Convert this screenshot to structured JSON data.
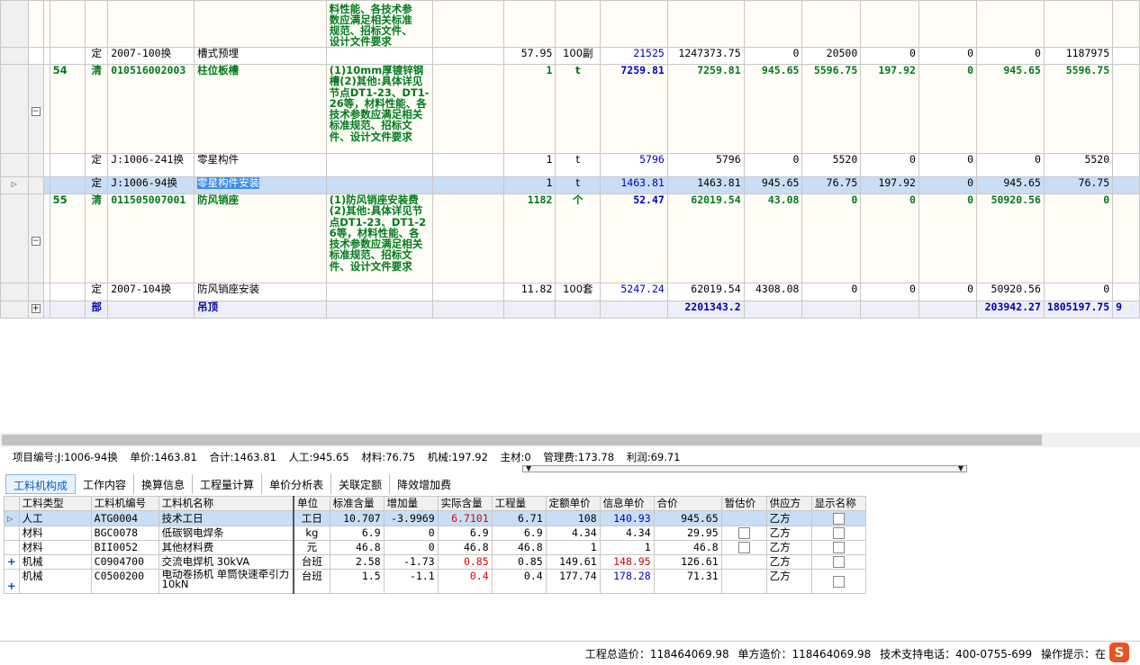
{
  "top_grid": {
    "overflow_row": {
      "description_lines": [
        "料性能、各技术参",
        "数应满足相关标准",
        "规范、招标文件、",
        "设计文件要求"
      ]
    },
    "rows": [
      {
        "kind": "quota",
        "cat": "定",
        "code": "2007-100换",
        "name": "槽式预埋",
        "desc": "",
        "qty": "57.95",
        "unit": "100副",
        "price": "21525",
        "total": "1247373.75",
        "c1": "0",
        "c2": "20500",
        "c3": "0",
        "c4": "0",
        "c5": "0",
        "c6": "1187975"
      },
      {
        "kind": "list",
        "seq": "54",
        "cat": "清",
        "code": "010516002003",
        "name": "柱位板槽",
        "desc": "(1)10mm厚镀锌钢槽(2)其他:具体详见节点DT1-23、DT1-26等，材料性能、各技术参数应满足相关标准规范、招标文件、设计文件要求",
        "qty": "1",
        "unit": "t",
        "price": "7259.81",
        "total": "7259.81",
        "c1": "945.65",
        "c2": "5596.75",
        "c3": "197.92",
        "c4": "0",
        "c5": "945.65",
        "c6": "5596.75"
      },
      {
        "kind": "quota",
        "cat": "定",
        "code": "J:1006-241换",
        "name": "零星构件",
        "desc": "",
        "qty": "1",
        "unit": "t",
        "price": "5796",
        "total": "5796",
        "c1": "0",
        "c2": "5520",
        "c3": "0",
        "c4": "0",
        "c5": "0",
        "c6": "5520"
      },
      {
        "kind": "selected",
        "cat": "定",
        "code": "J:1006-94换",
        "name": "零星构件安装",
        "desc": "",
        "qty": "1",
        "unit": "t",
        "price": "1463.81",
        "total": "1463.81",
        "c1": "945.65",
        "c2": "76.75",
        "c3": "197.92",
        "c4": "0",
        "c5": "945.65",
        "c6": "76.75"
      },
      {
        "kind": "list",
        "seq": "55",
        "cat": "清",
        "code": "011505007001",
        "name": "防风销座",
        "desc": "(1)防风销座安装费(2)其他:具体详见节点DT1-23、DT1-26等，材料性能、各技术参数应满足相关标准规范、招标文件、设计文件要求",
        "qty": "1182",
        "unit": "个",
        "price": "52.47",
        "total": "62019.54",
        "c1": "43.08",
        "c2": "0",
        "c3": "0",
        "c4": "0",
        "c5": "50920.56",
        "c6": "0"
      },
      {
        "kind": "quota",
        "cat": "定",
        "code": "2007-104换",
        "name": "防风销座安装",
        "desc": "",
        "qty": "11.82",
        "unit": "100套",
        "price": "5247.24",
        "total": "62019.54",
        "c1": "4308.08",
        "c2": "0",
        "c3": "0",
        "c4": "0",
        "c5": "50920.56",
        "c6": "0"
      },
      {
        "kind": "section",
        "cat": "部",
        "code": "",
        "name": "吊顶",
        "desc": "",
        "qty": "",
        "unit": "",
        "price": "",
        "total": "2201343.2",
        "c1": "",
        "c2": "",
        "c3": "",
        "c4": "",
        "c5": "203942.27",
        "c6": "1805197.75",
        "c7": "9"
      }
    ]
  },
  "info_bar": {
    "code": "项目编号:J:1006-94换",
    "unit_price": "单价:1463.81",
    "total": "合计:1463.81",
    "labor": "人工:945.65",
    "material": "材料:76.75",
    "machine": "机械:197.92",
    "main_material": "主材:0",
    "management": "管理费:173.78",
    "profit": "利润:69.71"
  },
  "tabs": [
    "工料机构成",
    "工作内容",
    "换算信息",
    "工程量计算",
    "单价分析表",
    "关联定额",
    "降效增加费"
  ],
  "sub_table": {
    "headers": [
      "工料类型",
      "工料机编号",
      "工料机名称",
      "单位",
      "标准含量",
      "增加量",
      "实际含量",
      "工程量",
      "定额单价",
      "信息单价",
      "合价",
      "暂估价",
      "供应方",
      "显示名称"
    ],
    "rows": [
      {
        "type": "人工",
        "code": "ATG0004",
        "name": "技术工日",
        "unit": "工日",
        "std": "10.707",
        "add": "-3.9969",
        "actual": "6.7101",
        "qty": "6.71",
        "quota_price": "108",
        "info_price": "140.93",
        "total": "945.65",
        "supplier": "乙方"
      },
      {
        "type": "材料",
        "code": "BGC0078",
        "name": "低碳钢电焊条",
        "unit": "kg",
        "std": "6.9",
        "add": "0",
        "actual": "6.9",
        "qty": "6.9",
        "quota_price": "4.34",
        "info_price": "4.34",
        "total": "29.95",
        "supplier": "乙方"
      },
      {
        "type": "材料",
        "code": "BII0052",
        "name": "其他材料费",
        "unit": "元",
        "std": "46.8",
        "add": "0",
        "actual": "46.8",
        "qty": "46.8",
        "quota_price": "1",
        "info_price": "1",
        "total": "46.8",
        "supplier": "乙方"
      },
      {
        "type": "机械",
        "code": "C0904700",
        "name": "交流电焊机 30kVA",
        "unit": "台班",
        "std": "2.58",
        "add": "-1.73",
        "actual": "0.85",
        "qty": "0.85",
        "quota_price": "149.61",
        "info_price": "148.95",
        "total": "126.61",
        "supplier": "乙方"
      },
      {
        "type": "机械",
        "code": "C0500200",
        "name": "电动卷扬机 单筒快速牵引力10kN",
        "unit": "台班",
        "std": "1.5",
        "add": "-1.1",
        "actual": "0.4",
        "qty": "0.4",
        "quota_price": "177.74",
        "info_price": "178.28",
        "total": "71.31",
        "supplier": "乙方"
      }
    ]
  },
  "status_bar": {
    "project_total": "工程总造价：118464069.98",
    "unit_cost": "单方造价：118464069.98",
    "support_phone": "技术支持电话：400-0755-699",
    "hint": "操作提示：在"
  },
  "ime_logo_letter": "S",
  "colors": {
    "selected_row": "#c7def5",
    "list_text": "#007a1e",
    "section_text": "#0000aa",
    "tab_active": "#0060c0"
  }
}
